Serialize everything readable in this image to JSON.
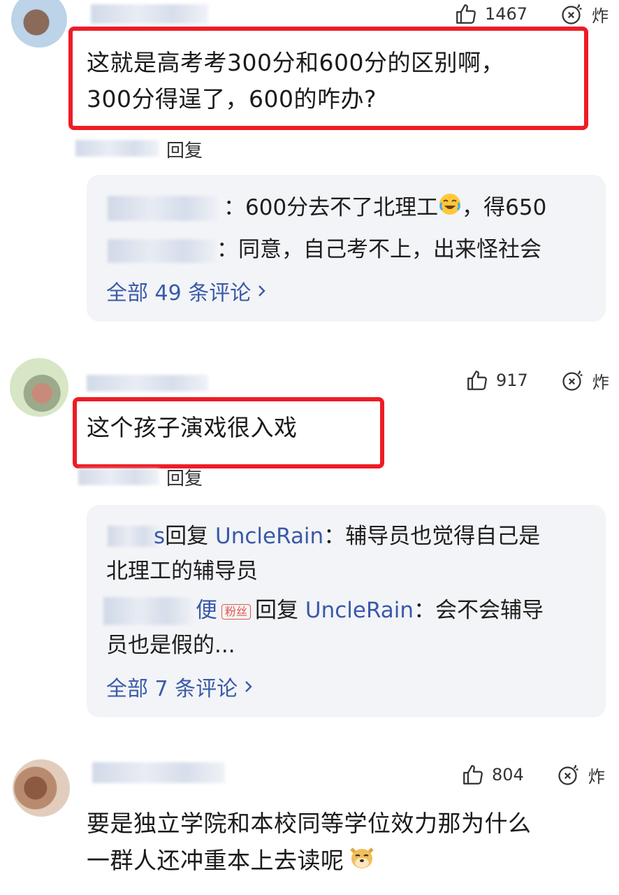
{
  "comments": [
    {
      "likes": "1467",
      "bomb_label": "炸",
      "text_line1": "这就是高考考300分和600分的区别啊，",
      "text_line2": "300分得逞了，600的咋办?",
      "reply_label": "回复",
      "sub_comments": [
        {
          "text": "：600分去不了北理工",
          "suffix": "，得650"
        },
        {
          "text": "：同意，自己考不上，出来怪社会"
        }
      ],
      "more_label": "全部 49 条评论"
    },
    {
      "likes": "917",
      "bomb_label": "炸",
      "text_line1": "这个孩子演戏很入戏",
      "reply_label": "回复",
      "sub_comments": [
        {
          "name_prefix": "s",
          "reply_word": "回复",
          "reply_to": "UncleRain",
          "text_a": "：辅导员也觉得自己是",
          "text_b": "北理工的辅导员"
        },
        {
          "name_prefix": "便",
          "fan_tag": "粉丝",
          "reply_word": "回复",
          "reply_to": "UncleRain",
          "text_a": "：会不会辅导",
          "text_b": "员也是假的..."
        }
      ],
      "more_label": "全部 7 条评论"
    },
    {
      "likes": "804",
      "bomb_label": "炸",
      "text_line1": "要是独立学院和本校同等学位效力那为什么",
      "text_line2": "一群人还冲重本上去读呢"
    }
  ],
  "icons": [
    "thumb-up-icon",
    "bomb-icon",
    "chevron-right-icon",
    "crying-laugh-emoji",
    "doge-emoji"
  ],
  "colors": {
    "highlight_border": "#ee1c25",
    "link_blue": "#3a5aa8",
    "sub_box_bg": "#f3f4f7"
  }
}
